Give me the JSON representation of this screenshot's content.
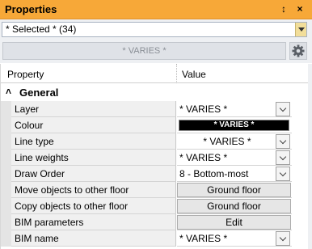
{
  "window": {
    "title": "Properties",
    "pin_glyph": "↕",
    "close_glyph": "×"
  },
  "selection": {
    "value": "* Selected * (34)"
  },
  "varies_button": {
    "label": "* VARIES *"
  },
  "grid": {
    "header": {
      "property": "Property",
      "value": "Value"
    },
    "category": {
      "label": "General",
      "icon": "collapse-icon",
      "icon_glyph": "˄"
    },
    "rows": [
      {
        "label": "Layer",
        "value": "* VARIES *",
        "kind": "dropdown"
      },
      {
        "label": "Colour",
        "value": "* VARIES *",
        "kind": "colour"
      },
      {
        "label": "Line type",
        "value": "* VARIES *",
        "kind": "dropdown-center"
      },
      {
        "label": "Line weights",
        "value": "* VARIES *",
        "kind": "dropdown"
      },
      {
        "label": "Draw Order",
        "value": "8 - Bottom-most",
        "kind": "dropdown"
      },
      {
        "label": "Move objects to other floor",
        "value": "Ground floor",
        "kind": "button"
      },
      {
        "label": "Copy objects to other floor",
        "value": "Ground floor",
        "kind": "button"
      },
      {
        "label": "BIM parameters",
        "value": "Edit",
        "kind": "button"
      },
      {
        "label": "BIM name",
        "value": "* VARIES *",
        "kind": "dropdown"
      }
    ]
  },
  "colors": {
    "titlebar": "#f7a838",
    "select_arrow": "#f2de9a",
    "colour_swatch": "#000000"
  }
}
